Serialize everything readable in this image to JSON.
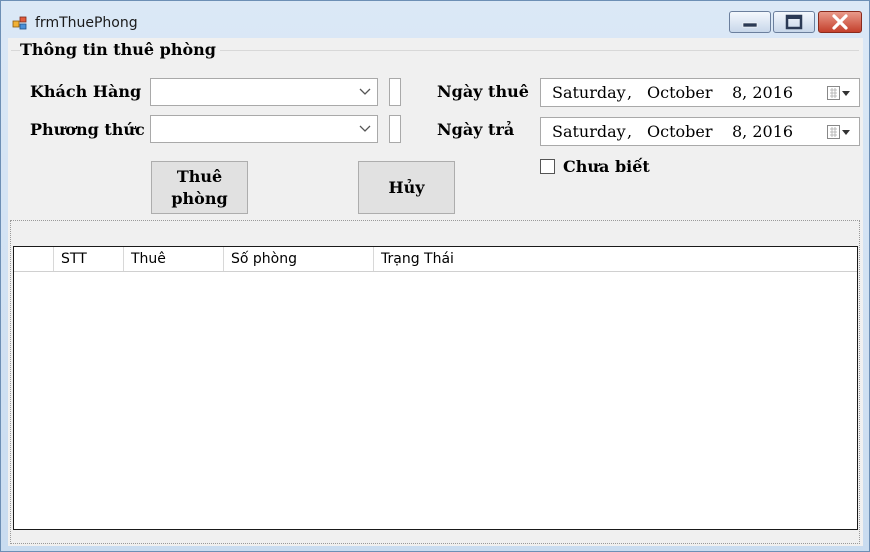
{
  "window": {
    "title": "frmThuePhong"
  },
  "group": {
    "title": "Thông tin thuê phòng"
  },
  "form": {
    "khach_hang_label": "Khách Hàng",
    "phuong_thuc_label": "Phương thức",
    "ngay_thue_label": "Ngày thuê",
    "ngay_tra_label": "Ngày trả",
    "ngay_thue": {
      "weekday": "Saturday",
      "sep": ",",
      "month": "October",
      "day_year": "8, 2016"
    },
    "ngay_tra": {
      "weekday": "Saturday",
      "sep": ",",
      "month": "October",
      "day_year": "8, 2016"
    },
    "chua_biet_label": "Chưa biết",
    "chua_biet_checked": false
  },
  "buttons": {
    "thue_line1": "Thuê",
    "thue_line2": "phòng",
    "huy": "Hủy"
  },
  "grid": {
    "columns": [
      "",
      "STT",
      "Thuê",
      "Số phòng",
      "Trạng Thái"
    ],
    "rows": []
  }
}
